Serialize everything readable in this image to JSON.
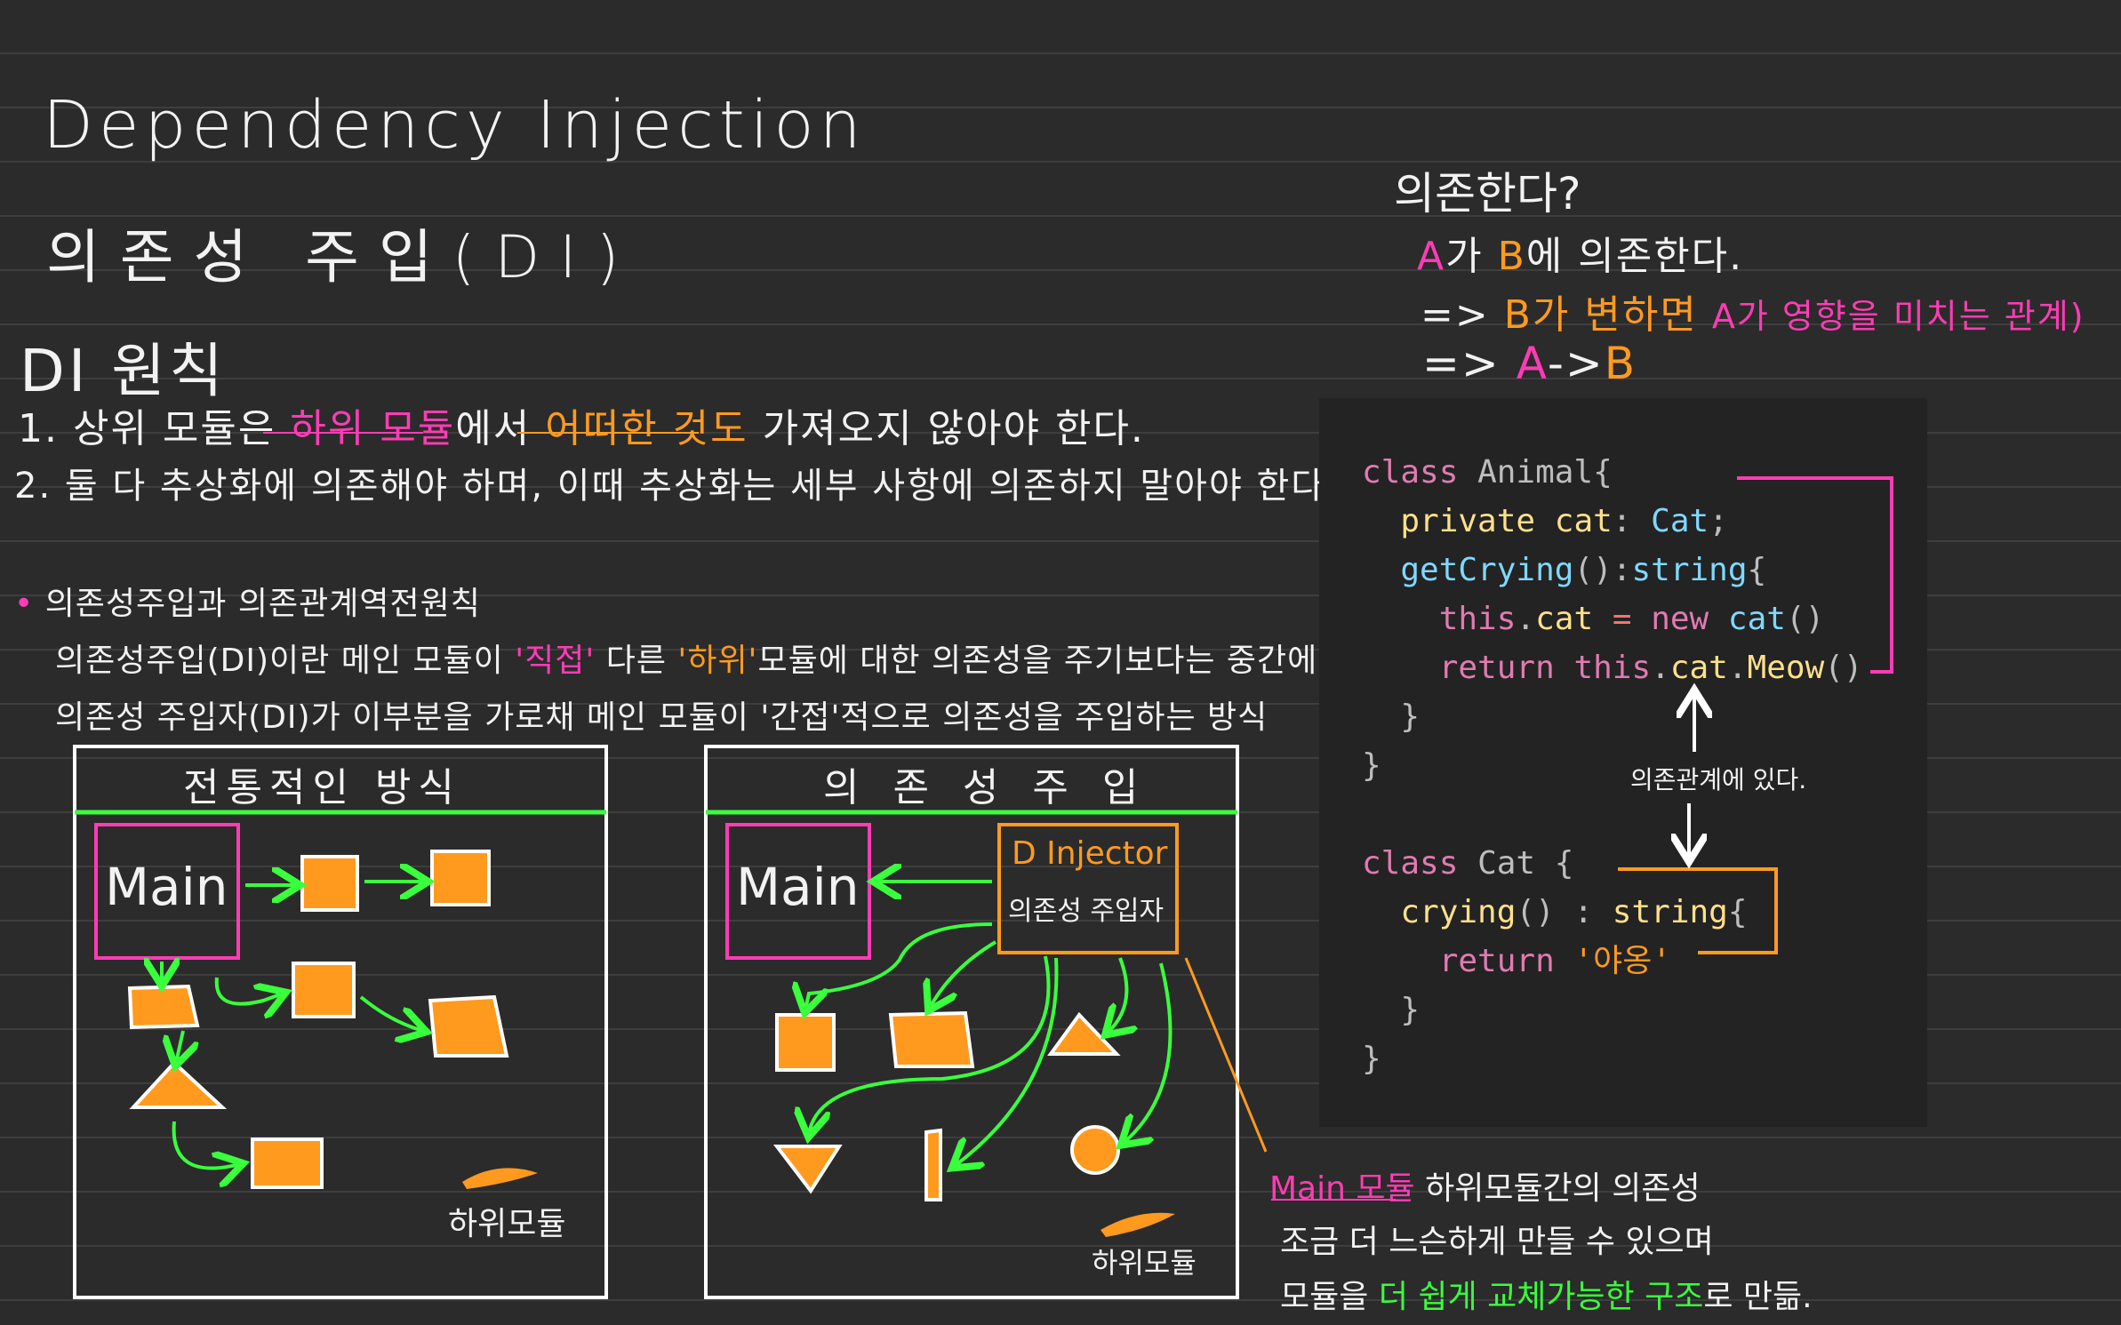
{
  "title": {
    "english": "Dependency Injection",
    "korean": "의존성 주입(DI)"
  },
  "principle": {
    "heading": "DI 원칙",
    "rule1": {
      "num": "1.",
      "part1": "상위 모듈은",
      "part2": "하위 모듈",
      "part3": "에서",
      "part4": "어떠한 것도",
      "part5": "가져오지 않아야 한다."
    },
    "rule2": "2. 둘 다 추상화에 의존해야 하며, 이때 추상화는 세부 사항에 의존하지 말아야 한다."
  },
  "note": {
    "bullet": "•",
    "heading": "의존성주입과 의존관계역전원칙",
    "line1": {
      "a": "의존성주입(DI)이란 메인 모듈이",
      "b": "'직접'",
      "c": "다른",
      "d": "'하위'",
      "e": "모듈에 대한 의존성을 주기보다는 중간에"
    },
    "line2": "의존성 주입자(DI)가 이부분을 가로채 메인 모듈이 '간접'적으로 의존성을 주입하는 방식"
  },
  "diagram_left": {
    "title": "전통적인 방식",
    "main_label": "Main",
    "legend": "하위모듈"
  },
  "diagram_right": {
    "title": "의 존 성 주 입",
    "main_label": "Main",
    "injector_label": "D Injector",
    "injector_sub": "의존성 주입자",
    "legend": "하위모듈"
  },
  "dependency": {
    "question": "의존한다?",
    "line1": {
      "a": "A",
      "b": "가",
      "c": "B",
      "d": "에 의존한다."
    },
    "line2": {
      "arrow": "=>",
      "a": "B가 변하면",
      "b": "A가 영향을 미치는 관계)"
    },
    "line3": {
      "arrow": "=>",
      "a": "A",
      "b": "->",
      "c": "B"
    }
  },
  "code_annotation": "의존관계에 있다.",
  "summary": {
    "line1": {
      "a": "Main 모듈",
      "b": "하위모듈간의 의존성"
    },
    "line2": "조금 더 느슨하게 만들 수 있으며",
    "line3": {
      "a": "모듈을",
      "b": "더 쉽게 교체가능한 구조",
      "c": "로 만듦."
    }
  },
  "colors": {
    "background": "#2b2b2b",
    "pink": "#ff3cb5",
    "orange": "#ff9a1f",
    "green": "#39ff3c",
    "code_bg": "#232323"
  }
}
